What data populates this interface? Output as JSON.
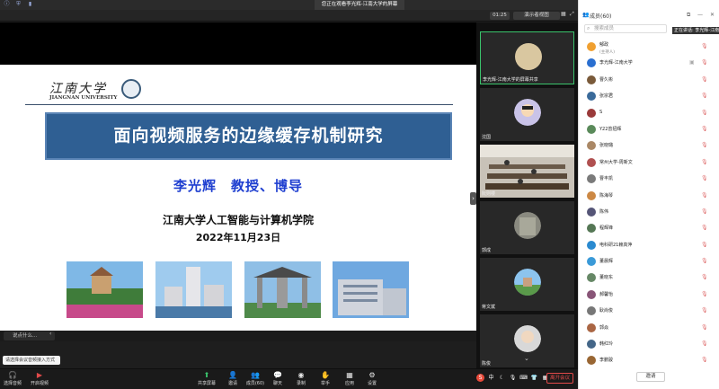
{
  "window": {
    "banner": "您正在观看李光辉-江南大学的屏幕",
    "timer": "01:25",
    "view_label": "演示者视图"
  },
  "slide": {
    "logo_cn": "江南大学",
    "logo_en": "JIANGNAN UNIVERSITY",
    "title": "面向视频服务的边缘缓存机制研究",
    "author": "李光辉　教授、博导",
    "school": "江南大学人工智能与计算机学院",
    "date": "2022年11月23日"
  },
  "chat": {
    "placeholder": "说点什么..."
  },
  "toast": "请选择会议音频接入方式",
  "toolbar": {
    "audio": "选择音频",
    "video": "开启视频",
    "share": "共享屏幕",
    "invite": "邀请",
    "members": "成员(60)",
    "chat": "聊天",
    "record": "录制",
    "raise": "举手",
    "apps": "应用",
    "settings": "设置",
    "leave": "离开会议"
  },
  "video_tiles": [
    {
      "label": "李光辉-江南大学的屏幕共享",
      "active": true
    },
    {
      "label": "沈国"
    },
    {
      "label": "阮则楼"
    },
    {
      "label": "郭成"
    },
    {
      "label": "蒋文斌"
    },
    {
      "label": "陈俊"
    }
  ],
  "panel": {
    "title": "成员(60)",
    "search_placeholder": "搜索成员",
    "speaking": "正在讲话: 李光辉-江南大学; 蒋...",
    "invite_label": "邀请",
    "members": [
      {
        "name": "郁政",
        "role": "(主持人)",
        "color": "#f0a030"
      },
      {
        "name": "李光辉-江南大学",
        "color": "#2a6fd0"
      },
      {
        "name": "曹久彬",
        "color": "#7a5a3a"
      },
      {
        "name": "张宗君",
        "color": "#3a6a9a"
      },
      {
        "name": "S",
        "color": "#9a3a3a"
      },
      {
        "name": "Y22曾招辉",
        "color": "#5a8a5a"
      },
      {
        "name": "张晓璐",
        "color": "#aa8866"
      },
      {
        "name": "常州大学-周新文",
        "color": "#b05050"
      },
      {
        "name": "曹丰凯",
        "color": "#7a7a7a"
      },
      {
        "name": "陈海琴",
        "color": "#cc8844"
      },
      {
        "name": "陈伟",
        "color": "#555577"
      },
      {
        "name": "程辉锋",
        "color": "#557755"
      },
      {
        "name": "电科研21赖高萍",
        "color": "#2a8ad0"
      },
      {
        "name": "董晨辉",
        "color": "#3a9ad8"
      },
      {
        "name": "董晓东",
        "color": "#668866"
      },
      {
        "name": "郝馨怡",
        "color": "#885577"
      },
      {
        "name": "耿尚俊",
        "color": "#777777"
      },
      {
        "name": "郭焱",
        "color": "#aa6644"
      },
      {
        "name": "韩红玲",
        "color": "#446688"
      },
      {
        "name": "李鹏骏",
        "color": "#996633"
      }
    ]
  }
}
